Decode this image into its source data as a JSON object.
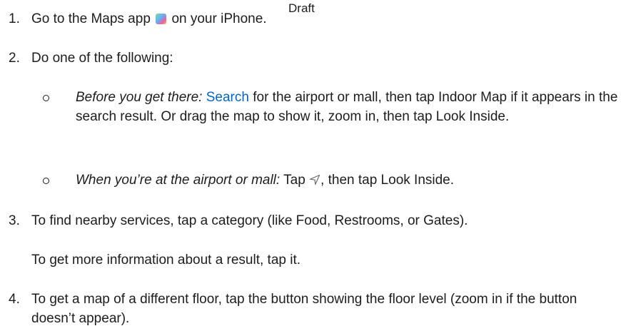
{
  "draft_label": "Draft",
  "steps": [
    {
      "num": "1.",
      "text_before": "Go to the Maps app",
      "text_after": "on your iPhone."
    },
    {
      "num": "2.",
      "text": "Do one of the following:",
      "subitems": [
        {
          "lead": "Before you get there:",
          "link": "Search",
          "rest": "for the airport or mall, then tap Indoor Map if it appears in the search result. Or drag the map to show it, zoom in, then tap Look Inside."
        },
        {
          "lead": "When you’re at the airport or mall:",
          "before_icon": "Tap",
          "after_icon": ", then tap Look Inside."
        }
      ]
    },
    {
      "num": "3.",
      "text": "To find nearby services, tap a category (like Food, Restrooms, or Gates).",
      "extra": "To get more information about a result, tap it."
    },
    {
      "num": "4.",
      "text": "To get a map of a different floor, tap the button showing the floor level (zoom in if the button doesn’t appear)."
    }
  ],
  "icons": {
    "maps": "maps-app-icon",
    "location": "location-arrow-icon"
  },
  "colors": {
    "text": "#1d1d1f",
    "link": "#0066cc"
  }
}
